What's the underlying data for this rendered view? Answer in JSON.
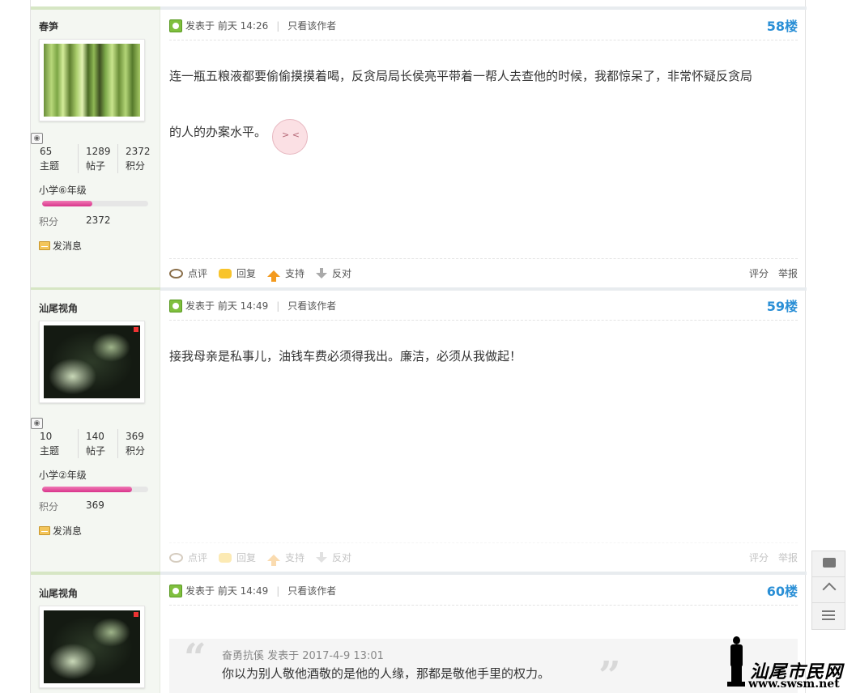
{
  "posts": [
    {
      "author": "春笋",
      "stats": [
        {
          "num": "65",
          "label": "主题"
        },
        {
          "num": "1289",
          "label": "帖子"
        },
        {
          "num": "2372",
          "label": "积分"
        }
      ],
      "rank": "小学⑥年级",
      "rank_progress": 0.47,
      "credit_label": "积分",
      "credit_value": "2372",
      "pm": "发消息",
      "time": "发表于  前天 14:26",
      "only_author": "只看该作者",
      "floor": "58楼",
      "body_line1": "连一瓶五粮液都要偷偷摸摸着喝，反贪局局长侯亮平带着一帮人去查他的时候，我都惊呆了，非常怀疑反贪局",
      "body_line2": "的人的办案水平。",
      "emoticon": "顶",
      "actions": {
        "comment": "点评",
        "reply": "回复",
        "support": "支持",
        "oppose": "反对",
        "rate": "评分",
        "report": "举报"
      }
    },
    {
      "author": "汕尾视角",
      "stats": [
        {
          "num": "10",
          "label": "主题"
        },
        {
          "num": "140",
          "label": "帖子"
        },
        {
          "num": "369",
          "label": "积分"
        }
      ],
      "rank": "小学②年级",
      "rank_progress": 0.85,
      "credit_label": "积分",
      "credit_value": "369",
      "pm": "发消息",
      "time": "发表于  前天 14:49",
      "only_author": "只看该作者",
      "floor": "59楼",
      "body_line1": "接我母亲是私事儿，油钱车费必须得我出。廉洁，必须从我做起！",
      "actions": {
        "comment": "点评",
        "reply": "回复",
        "support": "支持",
        "oppose": "反对",
        "rate": "评分",
        "report": "举报"
      }
    },
    {
      "author": "汕尾视角",
      "time": "发表于  前天 14:49",
      "only_author": "只看该作者",
      "floor": "60楼",
      "quote_meta": "奋勇抗傒 发表于 2017-4-9 13:01",
      "quote_text": "你以为别人敬他酒敬的是他的人缘，那都是敬他手里的权力。"
    }
  ],
  "watermark": {
    "title": "汕尾市民网",
    "url": "www.swsm.net"
  },
  "colors": {
    "floor": "#2a8fd6",
    "rank_bar": "#e0449a",
    "sidebar_bg": "#f4f7f2"
  }
}
